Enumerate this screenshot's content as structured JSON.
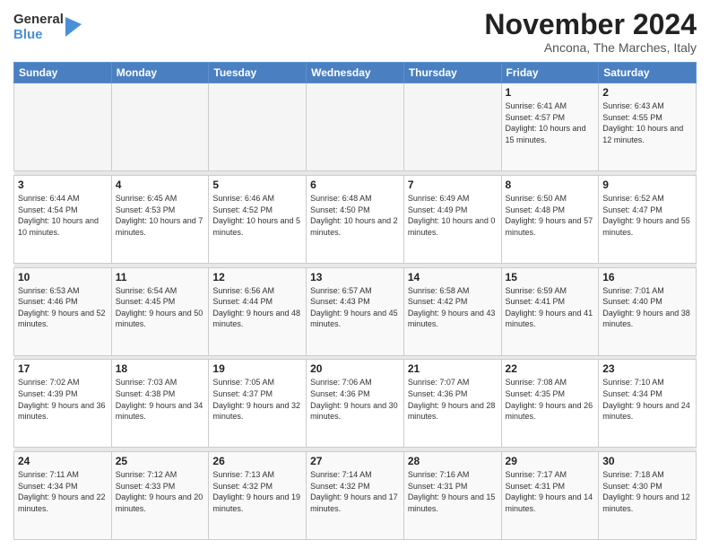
{
  "logo": {
    "general": "General",
    "blue": "Blue"
  },
  "title": "November 2024",
  "location": "Ancona, The Marches, Italy",
  "days_header": [
    "Sunday",
    "Monday",
    "Tuesday",
    "Wednesday",
    "Thursday",
    "Friday",
    "Saturday"
  ],
  "weeks": [
    [
      {
        "day": "",
        "info": ""
      },
      {
        "day": "",
        "info": ""
      },
      {
        "day": "",
        "info": ""
      },
      {
        "day": "",
        "info": ""
      },
      {
        "day": "",
        "info": ""
      },
      {
        "day": "1",
        "info": "Sunrise: 6:41 AM\nSunset: 4:57 PM\nDaylight: 10 hours and 15 minutes."
      },
      {
        "day": "2",
        "info": "Sunrise: 6:43 AM\nSunset: 4:55 PM\nDaylight: 10 hours and 12 minutes."
      }
    ],
    [
      {
        "day": "3",
        "info": "Sunrise: 6:44 AM\nSunset: 4:54 PM\nDaylight: 10 hours and 10 minutes."
      },
      {
        "day": "4",
        "info": "Sunrise: 6:45 AM\nSunset: 4:53 PM\nDaylight: 10 hours and 7 minutes."
      },
      {
        "day": "5",
        "info": "Sunrise: 6:46 AM\nSunset: 4:52 PM\nDaylight: 10 hours and 5 minutes."
      },
      {
        "day": "6",
        "info": "Sunrise: 6:48 AM\nSunset: 4:50 PM\nDaylight: 10 hours and 2 minutes."
      },
      {
        "day": "7",
        "info": "Sunrise: 6:49 AM\nSunset: 4:49 PM\nDaylight: 10 hours and 0 minutes."
      },
      {
        "day": "8",
        "info": "Sunrise: 6:50 AM\nSunset: 4:48 PM\nDaylight: 9 hours and 57 minutes."
      },
      {
        "day": "9",
        "info": "Sunrise: 6:52 AM\nSunset: 4:47 PM\nDaylight: 9 hours and 55 minutes."
      }
    ],
    [
      {
        "day": "10",
        "info": "Sunrise: 6:53 AM\nSunset: 4:46 PM\nDaylight: 9 hours and 52 minutes."
      },
      {
        "day": "11",
        "info": "Sunrise: 6:54 AM\nSunset: 4:45 PM\nDaylight: 9 hours and 50 minutes."
      },
      {
        "day": "12",
        "info": "Sunrise: 6:56 AM\nSunset: 4:44 PM\nDaylight: 9 hours and 48 minutes."
      },
      {
        "day": "13",
        "info": "Sunrise: 6:57 AM\nSunset: 4:43 PM\nDaylight: 9 hours and 45 minutes."
      },
      {
        "day": "14",
        "info": "Sunrise: 6:58 AM\nSunset: 4:42 PM\nDaylight: 9 hours and 43 minutes."
      },
      {
        "day": "15",
        "info": "Sunrise: 6:59 AM\nSunset: 4:41 PM\nDaylight: 9 hours and 41 minutes."
      },
      {
        "day": "16",
        "info": "Sunrise: 7:01 AM\nSunset: 4:40 PM\nDaylight: 9 hours and 38 minutes."
      }
    ],
    [
      {
        "day": "17",
        "info": "Sunrise: 7:02 AM\nSunset: 4:39 PM\nDaylight: 9 hours and 36 minutes."
      },
      {
        "day": "18",
        "info": "Sunrise: 7:03 AM\nSunset: 4:38 PM\nDaylight: 9 hours and 34 minutes."
      },
      {
        "day": "19",
        "info": "Sunrise: 7:05 AM\nSunset: 4:37 PM\nDaylight: 9 hours and 32 minutes."
      },
      {
        "day": "20",
        "info": "Sunrise: 7:06 AM\nSunset: 4:36 PM\nDaylight: 9 hours and 30 minutes."
      },
      {
        "day": "21",
        "info": "Sunrise: 7:07 AM\nSunset: 4:36 PM\nDaylight: 9 hours and 28 minutes."
      },
      {
        "day": "22",
        "info": "Sunrise: 7:08 AM\nSunset: 4:35 PM\nDaylight: 9 hours and 26 minutes."
      },
      {
        "day": "23",
        "info": "Sunrise: 7:10 AM\nSunset: 4:34 PM\nDaylight: 9 hours and 24 minutes."
      }
    ],
    [
      {
        "day": "24",
        "info": "Sunrise: 7:11 AM\nSunset: 4:34 PM\nDaylight: 9 hours and 22 minutes."
      },
      {
        "day": "25",
        "info": "Sunrise: 7:12 AM\nSunset: 4:33 PM\nDaylight: 9 hours and 20 minutes."
      },
      {
        "day": "26",
        "info": "Sunrise: 7:13 AM\nSunset: 4:32 PM\nDaylight: 9 hours and 19 minutes."
      },
      {
        "day": "27",
        "info": "Sunrise: 7:14 AM\nSunset: 4:32 PM\nDaylight: 9 hours and 17 minutes."
      },
      {
        "day": "28",
        "info": "Sunrise: 7:16 AM\nSunset: 4:31 PM\nDaylight: 9 hours and 15 minutes."
      },
      {
        "day": "29",
        "info": "Sunrise: 7:17 AM\nSunset: 4:31 PM\nDaylight: 9 hours and 14 minutes."
      },
      {
        "day": "30",
        "info": "Sunrise: 7:18 AM\nSunset: 4:30 PM\nDaylight: 9 hours and 12 minutes."
      }
    ]
  ]
}
